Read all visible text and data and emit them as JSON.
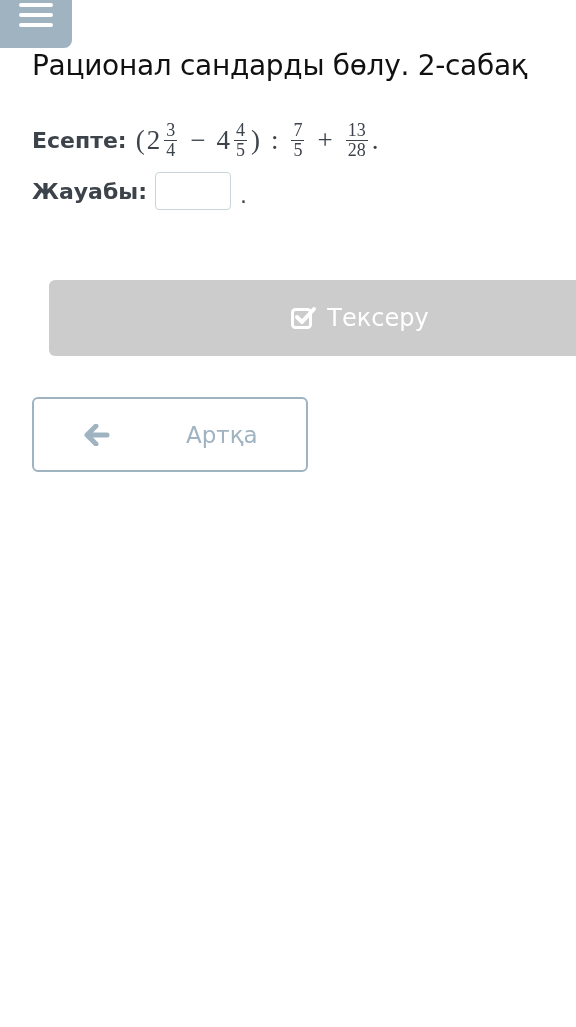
{
  "title": "Рационал сандарды бөлу. 2-сабақ",
  "problem": {
    "label": "Есепте:",
    "expression": [
      {
        "kind": "text",
        "text": "("
      },
      {
        "kind": "text",
        "text": "2"
      },
      {
        "kind": "frac",
        "num": "3",
        "den": "4"
      },
      {
        "kind": "op",
        "text": "−"
      },
      {
        "kind": "text",
        "text": "4"
      },
      {
        "kind": "frac",
        "num": "4",
        "den": "5"
      },
      {
        "kind": "text",
        "text": ")"
      },
      {
        "kind": "op",
        "text": ":"
      },
      {
        "kind": "frac",
        "num": "7",
        "den": "5"
      },
      {
        "kind": "op",
        "text": "+"
      },
      {
        "kind": "frac",
        "num": "13",
        "den": "28"
      },
      {
        "kind": "text",
        "text": "."
      }
    ]
  },
  "answer": {
    "label": "Жауабы:",
    "suffix": "."
  },
  "check_button": {
    "label": "Тексеру",
    "disabled": true
  },
  "back_button": {
    "label": "Артқа"
  }
}
